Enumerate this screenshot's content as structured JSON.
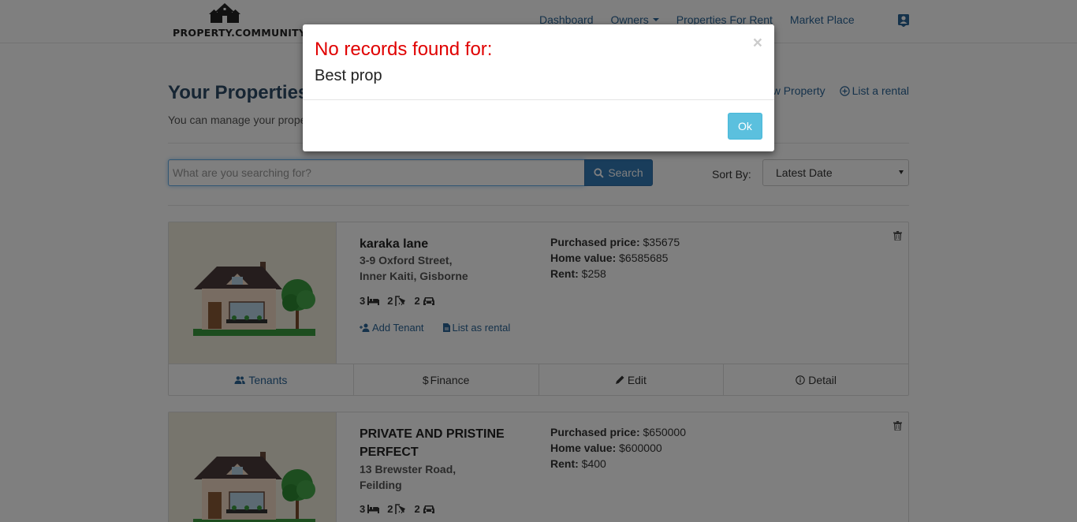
{
  "brand": {
    "logo_text": "PROPERTY.COMMUNITY"
  },
  "nav": {
    "dashboard": "Dashboard",
    "owners": "Owners",
    "properties_for_rent": "Properties For Rent",
    "market_place": "Market Place"
  },
  "header": {
    "title": "Your Properties",
    "subtitle": "You can manage your properties here",
    "add_property": "Add New Property",
    "list_rental": "List a rental"
  },
  "search": {
    "placeholder": "What are you searching for?",
    "button": "Search",
    "sort_label": "Sort By:",
    "sort_value": "Latest Date"
  },
  "properties": [
    {
      "name": "karaka lane",
      "address_line1": "3-9 Oxford Street,",
      "address_line2": "Inner Kaiti, Gisborne",
      "beds": "3",
      "baths": "2",
      "cars": "2",
      "add_tenant": "Add Tenant",
      "list_as_rental": "List as rental",
      "purchased_label": "Purchased price:",
      "purchased_value": "$35675",
      "home_value_label": "Home value:",
      "home_value": "$6585685",
      "rent_label": "Rent:",
      "rent_value": "$258",
      "tabs": {
        "tenants": "Tenants",
        "finance": "Finance",
        "edit": "Edit",
        "detail": "Detail"
      }
    },
    {
      "name_line1": "PRIVATE AND PRISTINE",
      "name_line2": "PERFECT",
      "address_line1": "13 Brewster Road,",
      "address_line2": "Feilding",
      "beds": "3",
      "baths": "2",
      "cars": "2",
      "purchased_label": "Purchased price:",
      "purchased_value": "$650000",
      "home_value_label": "Home value:",
      "home_value": "$600000",
      "rent_label": "Rent:",
      "rent_value": "$400"
    }
  ],
  "modal": {
    "title": "No records found for:",
    "query": "Best prop",
    "close": "×",
    "ok": "Ok"
  },
  "colors": {
    "link": "#2a6496",
    "primary": "#337ab7",
    "info": "#5bc0de",
    "danger": "#e00000"
  }
}
